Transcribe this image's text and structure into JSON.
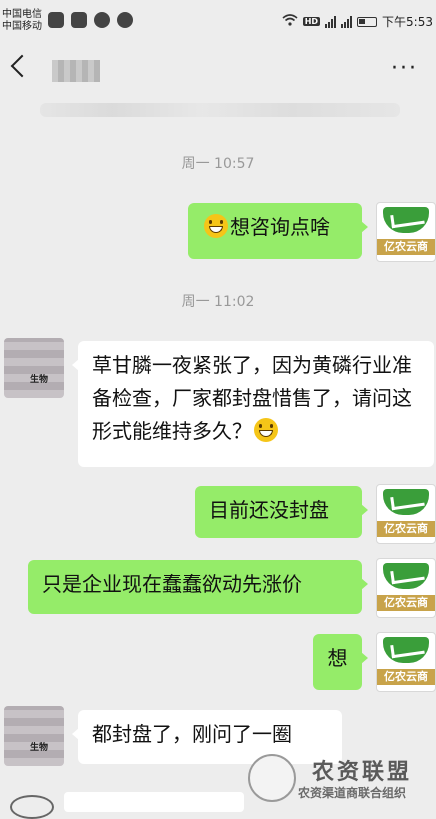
{
  "status_bar": {
    "carrier1": "中国电信",
    "carrier2": "中国移动",
    "network_label": "HD",
    "time": "下午5:53",
    "icons": [
      "wechat-icon",
      "image-icon",
      "app-icon",
      "cast-icon",
      "wifi-icon",
      "hd-icon",
      "signal-4g-icon",
      "signal-icon",
      "battery-icon"
    ]
  },
  "nav": {
    "back_icon": "chevron-left-icon",
    "more_label": "···"
  },
  "messages": [
    {
      "type": "time",
      "text": "周一 10:57"
    },
    {
      "type": "msg",
      "side": "right",
      "text": "想咨询点啥",
      "emoji": "grin-emoji"
    },
    {
      "type": "time",
      "text": "周一 11:02"
    },
    {
      "type": "msg",
      "side": "left",
      "text": "草甘膦一夜紧张了，因为黄磷行业准备检查，厂家都封盘惜售了，请问这形式能维持多久？",
      "emoji": "grin-emoji"
    },
    {
      "type": "msg",
      "side": "right",
      "text": "目前还没封盘"
    },
    {
      "type": "msg",
      "side": "right",
      "text": "只是企业现在蠢蠢欲动先涨价"
    },
    {
      "type": "msg",
      "side": "right",
      "text": "想"
    },
    {
      "type": "msg",
      "side": "left",
      "text": "都封盘了，刚问了一圈"
    }
  ],
  "avatars": {
    "brand_text": "亿农云商",
    "user_text": "生物"
  },
  "watermark": {
    "title": "农资联盟",
    "subtitle": "农资渠道商联合组织"
  },
  "colors": {
    "background": "#ededed",
    "bubble_right": "#95ec69",
    "bubble_left": "#ffffff",
    "brand_green": "#3a9e3a"
  }
}
